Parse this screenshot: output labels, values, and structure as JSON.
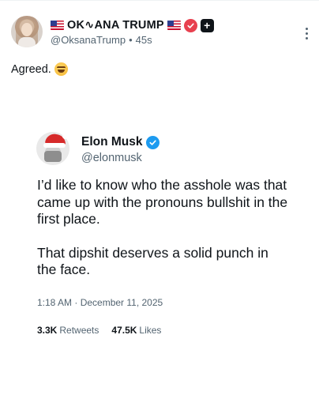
{
  "post": {
    "display_name": "OK∿ANA TRUMP",
    "handle": "@OksanaTrump",
    "separator": "•",
    "time_ago": "45s",
    "text": "Agreed.",
    "verified_badge_color": "#e8404f",
    "plus_badge": "+",
    "icons": [
      "us-flag-icon",
      "verified-icon",
      "plus-icon",
      "more-vertical-icon",
      "laughing-emoji-icon"
    ]
  },
  "quoted": {
    "name": "Elon Musk",
    "handle": "@elonmusk",
    "verified_badge_color": "#1d9bf0",
    "paragraph_1": "I’d like to know who the asshole was that came up with the pronouns bullshit in the first place.",
    "paragraph_2": "That dipshit deserves a solid punch in the face.",
    "timestamp": "1:18 AM · December 11, 2025",
    "retweets_count": "3.3K",
    "retweets_label": "Retweets",
    "likes_count": "47.5K",
    "likes_label": "Likes"
  }
}
